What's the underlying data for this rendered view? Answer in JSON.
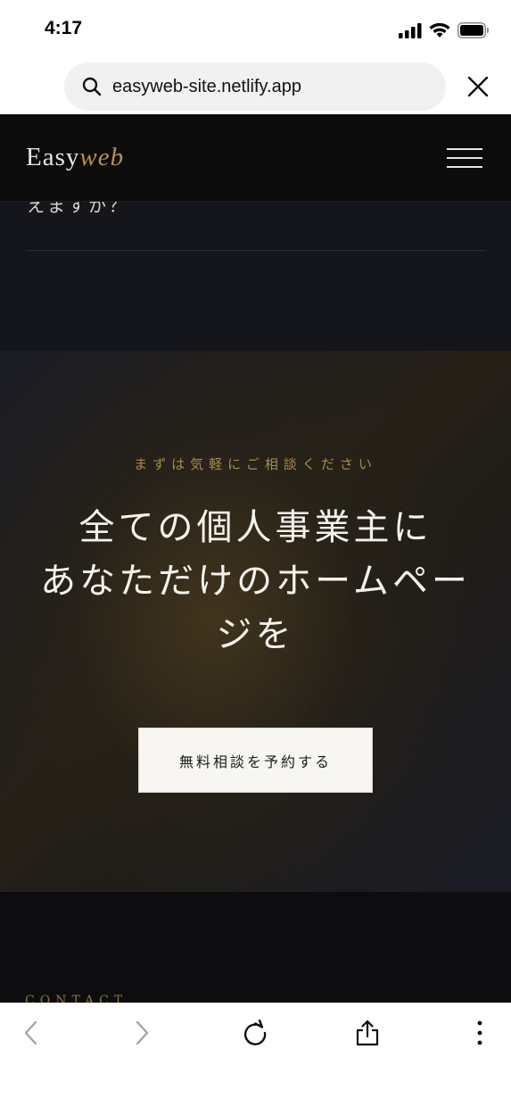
{
  "status_bar": {
    "time": "4:17"
  },
  "browser": {
    "url": "easyweb-site.netlify.app"
  },
  "site": {
    "logo_main": "Easy",
    "logo_accent": "web",
    "accent_color": "#b8924a"
  },
  "faq": {
    "partial_text": "えますか？"
  },
  "cta": {
    "tagline": "まずは気軽にご相談ください",
    "headline_line1": "全ての個人事業主に",
    "headline_line2": "あなただけのホームペー",
    "headline_line3": "ジを",
    "button_label": "無料相談を予約する"
  },
  "contact": {
    "label": "CONTACT"
  },
  "icons": {
    "status": [
      "cellular-signal-icon",
      "wifi-icon",
      "battery-icon"
    ],
    "toolbar": [
      "back-icon",
      "forward-icon",
      "reload-icon",
      "share-icon",
      "more-icon"
    ]
  }
}
